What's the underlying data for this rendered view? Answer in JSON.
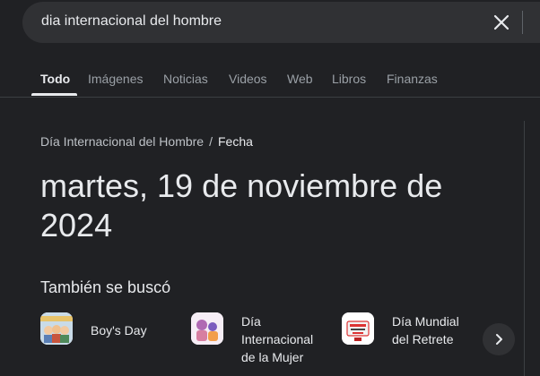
{
  "search": {
    "query": "dia internacional del hombre",
    "clear_icon": "close-icon"
  },
  "tabs": [
    {
      "label": "Todo",
      "active": true
    },
    {
      "label": "Imágenes",
      "active": false
    },
    {
      "label": "Noticias",
      "active": false
    },
    {
      "label": "Videos",
      "active": false
    },
    {
      "label": "Web",
      "active": false
    },
    {
      "label": "Libros",
      "active": false
    },
    {
      "label": "Finanzas",
      "active": false
    }
  ],
  "breadcrumb": {
    "entity": "Día Internacional del Hombre",
    "separator": "/",
    "attribute": "Fecha"
  },
  "answer": {
    "line1": "martes, 19 de noviembre de",
    "line2": "2024"
  },
  "also_searched": {
    "title": "También se buscó",
    "items": [
      {
        "label": "Boy's Day"
      },
      {
        "label": "Día Internacional de la Mujer"
      },
      {
        "label": "Día Mundial del Retrete"
      }
    ],
    "next_icon": "chevron-right-icon"
  },
  "colors": {
    "background": "#202124",
    "search_bar": "#303134",
    "text_primary": "#e8eaed",
    "text_secondary": "#9aa0a6"
  }
}
